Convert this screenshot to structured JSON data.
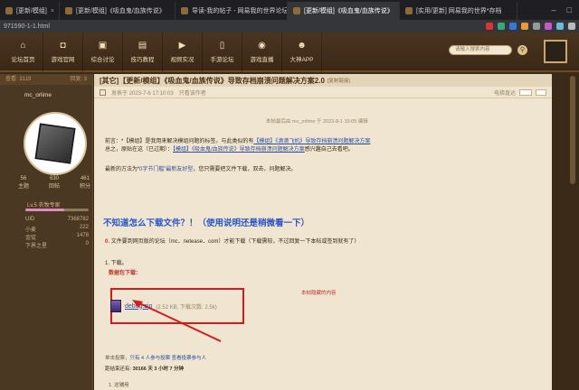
{
  "browser": {
    "tabs": [
      {
        "label": "[更新/模组]",
        "active": false
      },
      {
        "label": "[更新/模组]《吸血鬼/血族传说》",
        "active": false
      },
      {
        "label": "导读-我的帖子 - 网易我的世界论坛",
        "active": false
      },
      {
        "label": "[更新/模组]《吸血鬼/血族传说》",
        "active": true
      },
      {
        "label": "[实用/更新] 网易我的世界*存档",
        "active": false
      }
    ],
    "url": "971590-1-1.html"
  },
  "nav": {
    "items": [
      {
        "label": "论坛首页",
        "icon": "home-icon"
      },
      {
        "label": "游戏官网",
        "icon": "gamepad-icon"
      },
      {
        "label": "综合讨论",
        "icon": "chat-icon"
      },
      {
        "label": "技巧教程",
        "icon": "tutorial-icon"
      },
      {
        "label": "视频实况",
        "icon": "video-icon"
      },
      {
        "label": "手游论坛",
        "icon": "mobile-icon"
      },
      {
        "label": "游戏直播",
        "icon": "live-icon"
      },
      {
        "label": "大神APP",
        "icon": "app-icon"
      }
    ],
    "search_placeholder": "请输入搜索内容"
  },
  "sidebar": {
    "top_left": "查看: 3119",
    "top_right": "回复: 3",
    "username": "mc_orlime",
    "stats": [
      {
        "value": "56",
        "label": "主题"
      },
      {
        "value": "630",
        "label": "回帖"
      },
      {
        "value": "461",
        "label": "积分"
      }
    ],
    "rank": "Lv.5 农牧专家",
    "progress": 0.62,
    "info": [
      {
        "k": "UID",
        "v": "7368782"
      },
      {
        "k": "小麦",
        "v": "222"
      },
      {
        "k": "金锭",
        "v": "1478"
      },
      {
        "k": "下界之星",
        "v": "0"
      }
    ]
  },
  "post": {
    "title": "[其它]【更新/模组】《吸血鬼/血族传说》导致存档崩溃问题解决方案2.0",
    "copy_link": "[复制链接]",
    "meta_date": "发表于 2023-7-6 17:10:03",
    "meta_only_author": "只看该作者",
    "meta_right": "电梯直达",
    "edit_note": "本帖最后由 mc_orlime 于 2023-8-1 10:05 编辑",
    "intro_prefix": "前言：*【模组】是我用来解决模组问题的标签。与此类似的有",
    "intro_link1": "【模组】《滴滴飞机》导致存档崩溃问题解决方案",
    "intro_line2_prefix": "总之，原贴在这（已过期）：",
    "intro_link2": "【模组】《吸血鬼/血族传说》导致存档崩溃问题解决方案",
    "intro_line2_suffix": "感兴趣自己去看吧。",
    "method_prefix": "最新的方法为“",
    "method_highlight": "0字节门槛",
    "method_mid": "”",
    "method_highlight2": "最新友好型",
    "method_suffix": "，您只需要把文件下载，双击，问题解决。",
    "big_heading": "不知道怎么下载文件？！（使用说明还是稍微看一下）",
    "step0_num": "0.",
    "step0": "文件要到网页版的论坛（mc．netease．com）才能下载（下载需较，不过回复一下本帖或签到就有了）",
    "step1": "1. 下载。",
    "dl_header": "数据包下载：",
    "attachment_name": "debug.zip",
    "attachment_meta": "(2.52 KB, 下载次数: 2.5k)",
    "side_note": "本帖隐藏的内容",
    "footer1_prefix": "单击投票，",
    "footer1_link": "只有 4 人参与投票 查看投票参与人",
    "footer2_prefix": "距结束还有:",
    "footer2_time": "30166 天 3 小时 7 分钟",
    "footer3": "1. 这辅用"
  }
}
